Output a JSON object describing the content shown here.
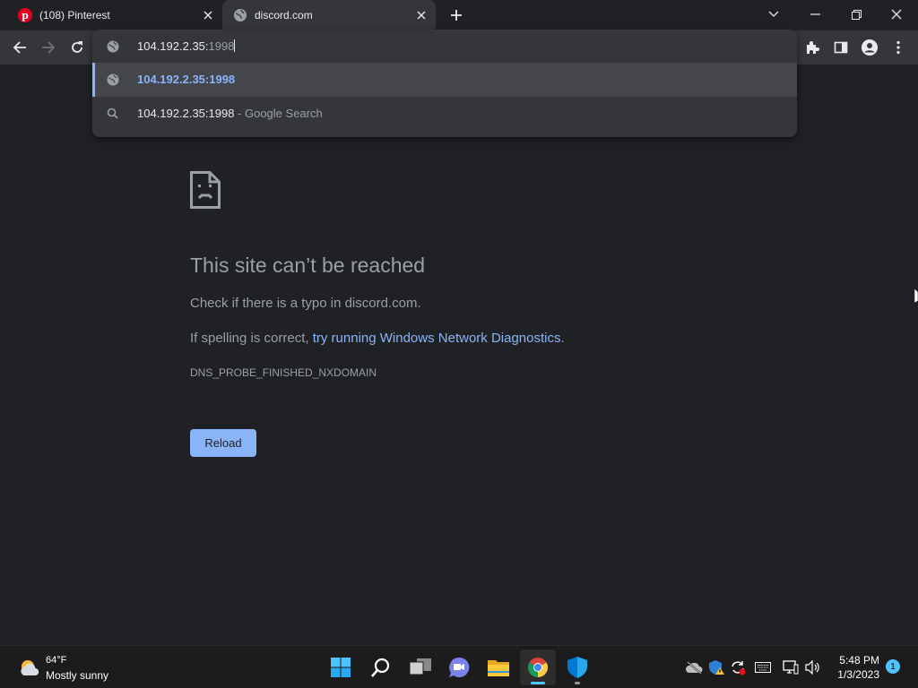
{
  "tabs": [
    {
      "title": "(108) Pinterest",
      "favicon": "pinterest-icon",
      "active": false
    },
    {
      "title": "discord.com",
      "favicon": "globe-icon",
      "active": true
    }
  ],
  "omnibox": {
    "typed": "104.192.2.35:",
    "autocomplete_suffix": "1998",
    "suggestions": [
      {
        "icon": "globe-icon",
        "text": "104.192.2.35:1998",
        "suffix": ""
      },
      {
        "icon": "search-icon",
        "text": "104.192.2.35:1998",
        "suffix": " - Google Search"
      }
    ]
  },
  "error_page": {
    "title": "This site can’t be reached",
    "line1": "Check if there is a typo in discord.com.",
    "line2_prefix": "If spelling is correct, ",
    "line2_link": "try running Windows Network Diagnostics",
    "line2_suffix": ".",
    "error_code": "DNS_PROBE_FINISHED_NXDOMAIN",
    "reload_label": "Reload"
  },
  "taskbar": {
    "weather_temp": "64°F",
    "weather_desc": "Mostly sunny",
    "apps": [
      "start-icon",
      "search-icon",
      "task-view-icon",
      "teams-chat-icon",
      "file-explorer-icon",
      "chrome-icon",
      "defender-icon"
    ],
    "clock_time": "5:48 PM",
    "clock_date": "1/3/2023",
    "notification_count": "1"
  },
  "colors": {
    "background": "#202124",
    "toolbar": "#35363a",
    "link": "#8ab4f8",
    "muted_text": "#9aa0a6"
  }
}
